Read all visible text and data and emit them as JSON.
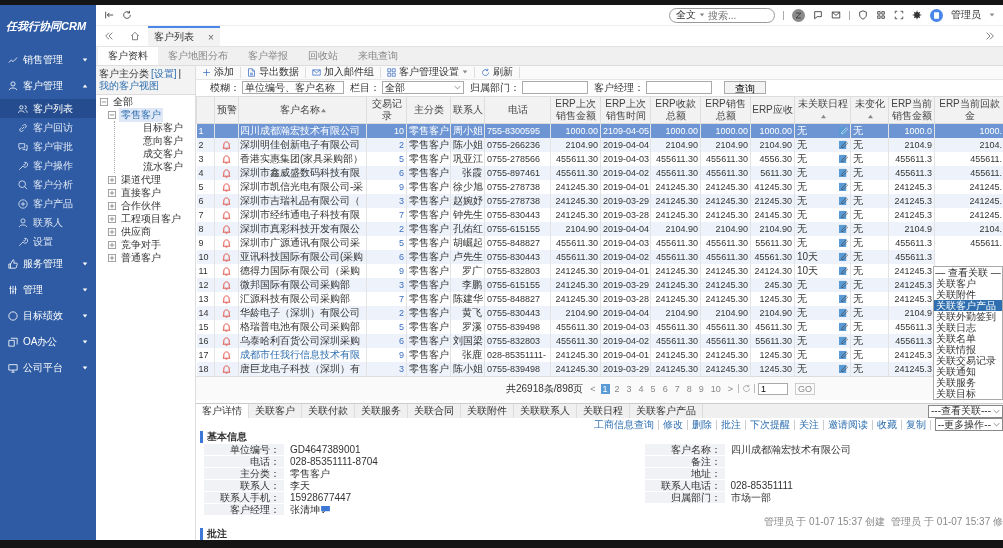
{
  "sidebar": {
    "logo": "任我行协同CRM",
    "menu": [
      {
        "label": "销售管理",
        "expanded": false
      },
      {
        "label": "客户管理",
        "expanded": true,
        "children": [
          {
            "label": "客户列表",
            "selected": true
          },
          {
            "label": "客户回访",
            "selected": false
          },
          {
            "label": "客户审批",
            "selected": false
          },
          {
            "label": "客户操作",
            "selected": false
          },
          {
            "label": "客户分析",
            "selected": false
          },
          {
            "label": "客户产品",
            "selected": false
          },
          {
            "label": "联系人",
            "selected": false
          },
          {
            "label": "设置",
            "selected": false
          }
        ]
      },
      {
        "label": "服务管理",
        "expanded": false
      },
      {
        "label": "管理",
        "expanded": false
      },
      {
        "label": "目标绩效",
        "expanded": false
      },
      {
        "label": "OA办公",
        "expanded": false
      },
      {
        "label": "公司平台",
        "expanded": false
      }
    ]
  },
  "topbar": {
    "search_scope": "全文",
    "search_placeholder": "搜索...",
    "user": "管理员"
  },
  "page_tabs": [
    {
      "label": "客户列表",
      "selected": true,
      "close": "×"
    }
  ],
  "sub_tabs": [
    {
      "label": "客户资料",
      "selected": true
    },
    {
      "label": "客户地图分布",
      "selected": false
    },
    {
      "label": "客户举报",
      "selected": false
    },
    {
      "label": "回收站",
      "selected": false
    },
    {
      "label": "来电查询",
      "selected": false
    }
  ],
  "tree": {
    "title": "客户主分类",
    "settings_link": "[设置]",
    "separator": "|",
    "view_link": "我的客户视图",
    "nodes": [
      {
        "label": "全部",
        "expanded": true,
        "selected": false,
        "children": [
          {
            "label": "零售客户",
            "expanded": true,
            "selected": true,
            "children": [
              {
                "label": "目标客户",
                "selected": false
              },
              {
                "label": "意向客户",
                "selected": false
              },
              {
                "label": "成交客户",
                "selected": false
              },
              {
                "label": "流水客户",
                "selected": false
              }
            ]
          },
          {
            "label": "渠道代理",
            "expanded": false,
            "selected": false
          },
          {
            "label": "直接客户",
            "expanded": false,
            "selected": false
          },
          {
            "label": "合作伙伴",
            "expanded": false,
            "selected": false
          },
          {
            "label": "工程项目客户",
            "expanded": false,
            "selected": false
          },
          {
            "label": "供应商",
            "expanded": false,
            "selected": false
          },
          {
            "label": "竞争对手",
            "expanded": false,
            "selected": false
          },
          {
            "label": "普通客户",
            "expanded": false,
            "selected": false
          }
        ]
      }
    ]
  },
  "toolbar": [
    {
      "label": "添加",
      "dropdown": false
    },
    {
      "label": "导出数据",
      "dropdown": false
    },
    {
      "label": "加入邮件组",
      "dropdown": false
    },
    {
      "label": "客户管理设置",
      "dropdown": true
    },
    {
      "label": "刷新",
      "dropdown": false
    }
  ],
  "filter": {
    "fuzzy_label": "模糊：",
    "fuzzy_placeholder": "单位编号、客户名称",
    "column_label": "栏目：",
    "column_value": "全部",
    "dept_label": "归属部门：",
    "manager_label": "客户经理：",
    "query": "查询"
  },
  "table": {
    "columns": [
      {},
      {
        "label": "预警",
        "sorted": false
      },
      {
        "label": "客户名称",
        "sorted": true
      },
      {
        "label": "交易记录",
        "sorted": false
      },
      {
        "label": "主分类",
        "sorted": false
      },
      {
        "label": "联系人",
        "sorted": false
      },
      {
        "label": "电话",
        "sorted": false
      },
      {
        "label": "ERP上次销售金额",
        "sorted": false
      },
      {
        "label": "ERP上次销售时间",
        "sorted": false
      },
      {
        "label": "ERP收款总额",
        "sorted": false
      },
      {
        "label": "ERP销售总额",
        "sorted": false
      },
      {
        "label": "ERP应收",
        "sorted": false
      },
      {
        "label": "未关联日程",
        "sorted": true
      },
      {
        "label": "未变化",
        "sorted": true
      },
      {
        "label": "ERP当前销售金额",
        "sorted": false
      },
      {
        "label": "ERP当前回款金",
        "sorted": false
      }
    ],
    "rows": [
      {
        "selected": true,
        "alert": false,
        "link": false,
        "cells": [
          "1",
          "",
          "四川成都瀚宏技术有限公司",
          "10",
          "零售客户",
          "周小姐",
          "755-8300595",
          "1000.00",
          "2109-04-05",
          "1000.00",
          "1000.00",
          "1000.00",
          "无",
          "无",
          "1000.0",
          "1000."
        ]
      },
      {
        "selected": false,
        "alert": true,
        "link": false,
        "cells": [
          "2",
          "",
          "深圳明佳创新电子有限公司",
          "2",
          "零售客户",
          "陈小姐",
          "0755-266236",
          "2104.90",
          "2019-04-04",
          "2104.90",
          "2104.90",
          "2104.90",
          "无",
          "无",
          "2104.9",
          "2104."
        ]
      },
      {
        "selected": false,
        "alert": true,
        "link": false,
        "cells": [
          "3",
          "",
          "香港实惠集团(家具采购部）",
          "5",
          "零售客户",
          "巩亚江",
          "0755-278566",
          "455611.30",
          "2019-04-03",
          "455611.30",
          "455611.30",
          "4556.30",
          "无",
          "无",
          "455611.3",
          "455611."
        ]
      },
      {
        "selected": false,
        "alert": true,
        "link": false,
        "cells": [
          "4",
          "",
          "深圳市鑫威盛数码科技有限",
          "6",
          "零售客户",
          "张霞",
          "0755-897461",
          "455611.30",
          "2019-04-02",
          "455611.30",
          "455611.30",
          "5611.30",
          "无",
          "无",
          "455611.3",
          "455611."
        ]
      },
      {
        "selected": false,
        "alert": true,
        "link": false,
        "cells": [
          "5",
          "",
          "深圳市凯信光电有限公司-采",
          "9",
          "零售客户",
          "徐少旭",
          "0755-278738",
          "241245.30",
          "2019-04-01",
          "241245.30",
          "241245.30",
          "41245.30",
          "无",
          "无",
          "241245.3",
          "241245."
        ]
      },
      {
        "selected": false,
        "alert": true,
        "link": false,
        "cells": [
          "6",
          "",
          "深圳市吉瑞礼品有限公司（",
          "3",
          "零售客户",
          "赵婉妤",
          "0755-278738",
          "241245.30",
          "2019-03-29",
          "241245.30",
          "241245.30",
          "21245.30",
          "无",
          "无",
          "241245.3",
          "241245."
        ]
      },
      {
        "selected": false,
        "alert": true,
        "link": false,
        "cells": [
          "7",
          "",
          "深圳市经纬通电子科技有限",
          "7",
          "零售客户",
          "钟先生",
          "0755-830443",
          "241245.30",
          "2019-03-28",
          "241245.30",
          "241245.30",
          "24145.30",
          "无",
          "无",
          "241245.3",
          "241245."
        ]
      },
      {
        "selected": false,
        "alert": true,
        "link": false,
        "cells": [
          "8",
          "",
          "深圳市真彩科技开发有限公",
          "2",
          "零售客户",
          "孔佑红",
          "0755-615155",
          "2104.90",
          "2019-04-04",
          "2104.90",
          "2104.90",
          "2104.90",
          "无",
          "无",
          "2104.9",
          "2104."
        ]
      },
      {
        "selected": false,
        "alert": true,
        "link": false,
        "cells": [
          "9",
          "",
          "深圳市广源通讯有限公司采",
          "5",
          "零售客户",
          "胡崛起",
          "0755-848827",
          "455611.30",
          "2019-04-03",
          "455611.30",
          "455611.30",
          "55611.30",
          "无",
          "无",
          "455611.3",
          "455611."
        ]
      },
      {
        "selected": false,
        "alert": true,
        "link": false,
        "cells": [
          "10",
          "",
          "亚讯科技国际有限公司(采购",
          "6",
          "零售客户",
          "卢先生",
          "0755-830443",
          "455611.30",
          "2019-04-02",
          "455611.30",
          "455611.30",
          "45561.30",
          "10天",
          "无",
          "455611.3"
        ]
      },
      {
        "selected": false,
        "alert": true,
        "link": false,
        "cells": [
          "11",
          "",
          "德得力国际有限公司（采购",
          "9",
          "零售客户",
          "罗广",
          "0755-832803",
          "241245.30",
          "2019-04-01",
          "241245.30",
          "241245.30",
          "24124.30",
          "10天",
          "无",
          "241245.3"
        ]
      },
      {
        "selected": false,
        "alert": true,
        "link": false,
        "cells": [
          "12",
          "",
          "微邦国际有限公司采购部",
          "3",
          "零售客户",
          "李鹏",
          "0755-615155",
          "241245.30",
          "2019-03-29",
          "241245.30",
          "241245.30",
          "245.30",
          "无",
          "无",
          "241245.3"
        ]
      },
      {
        "selected": false,
        "alert": true,
        "link": false,
        "cells": [
          "13",
          "",
          "汇源科技有限公司采购部",
          "7",
          "零售客户",
          "陈建华",
          "0755-848827",
          "241245.30",
          "2019-03-28",
          "241245.30",
          "241245.30",
          "1245.30",
          "无",
          "无",
          "241245.3"
        ]
      },
      {
        "selected": false,
        "alert": true,
        "link": false,
        "cells": [
          "14",
          "",
          "华龄电子（深圳）有限公司",
          "2",
          "零售客户",
          "黄飞",
          "0755-830443",
          "2104.90",
          "2019-04-04",
          "2104.90",
          "2104.90",
          "2104.90",
          "无",
          "无",
          "2104.9"
        ]
      },
      {
        "selected": false,
        "alert": true,
        "link": false,
        "cells": [
          "15",
          "",
          "格瑞普电池有限公司采购部",
          "5",
          "零售客户",
          "罗溪",
          "0755-839498",
          "455611.30",
          "2019-04-03",
          "455611.30",
          "455611.30",
          "45611.30",
          "无",
          "无",
          "455611.3"
        ]
      },
      {
        "selected": false,
        "alert": true,
        "link": false,
        "cells": [
          "16",
          "",
          "乌泰哈利百货公司深圳采购",
          "6",
          "零售客户",
          "刘国梁",
          "0755-832803",
          "455611.30",
          "2019-04-02",
          "455611.30",
          "455611.30",
          "55611.30",
          "无",
          "无",
          "455611.3"
        ]
      },
      {
        "selected": false,
        "alert": true,
        "link": true,
        "cells": [
          "17",
          "",
          "成都市任我行信息技术有限",
          "9",
          "零售客户",
          "张鹿",
          "028-85351111-",
          "241245.30",
          "2019-04-01",
          "241245.30",
          "241245.30",
          "1245.30",
          "无",
          "无",
          "241245.3"
        ]
      },
      {
        "selected": false,
        "alert": true,
        "link": false,
        "cells": [
          "18",
          "",
          "唐巨龙电子科技（深圳）有",
          "3",
          "零售客户",
          "陈小姐",
          "0755-839498",
          "241245.30",
          "2019-03-29",
          "241245.30",
          "241245.30",
          "1245.30",
          "无",
          "无",
          "241245.3"
        ]
      }
    ]
  },
  "pager": {
    "summary": "共26918条/898页",
    "prev": "<",
    "next": ">",
    "pages": [
      {
        "label": "1",
        "selected": true
      },
      {
        "label": "2",
        "selected": false
      },
      {
        "label": "3",
        "selected": false
      },
      {
        "label": "4",
        "selected": false
      },
      {
        "label": "5",
        "selected": false
      },
      {
        "label": "6",
        "selected": false
      },
      {
        "label": "7",
        "selected": false
      },
      {
        "label": "8",
        "selected": false
      },
      {
        "label": "9",
        "selected": false
      },
      {
        "label": "10",
        "selected": false
      }
    ],
    "page_input": "1",
    "go": "GO"
  },
  "related_menu": {
    "header": "— 查看关联 —",
    "items": [
      {
        "label": "关联客户",
        "selected": false
      },
      {
        "label": "关联附件",
        "selected": false
      },
      {
        "label": "关联客户产品",
        "selected": true
      },
      {
        "label": "关联外勤签到",
        "selected": false
      },
      {
        "label": "关联日志",
        "selected": false
      },
      {
        "label": "关联名单",
        "selected": false
      },
      {
        "label": "关联情报",
        "selected": false
      },
      {
        "label": "关联交易记录",
        "selected": false
      },
      {
        "label": "关联通知",
        "selected": false
      },
      {
        "label": "关联服务",
        "selected": false
      },
      {
        "label": "关联目标",
        "selected": false
      }
    ]
  },
  "detail_tabs": [
    {
      "label": "客户详情",
      "selected": true
    },
    {
      "label": "关联客户",
      "selected": false
    },
    {
      "label": "关联付款",
      "selected": false
    },
    {
      "label": "关联服务",
      "selected": false
    },
    {
      "label": "关联合同",
      "selected": false
    },
    {
      "label": "关联附件",
      "selected": false
    },
    {
      "label": "关联联系人",
      "selected": false
    },
    {
      "label": "关联日程",
      "selected": false
    },
    {
      "label": "关联客户产品",
      "selected": false
    }
  ],
  "related_select": "---查看关联---",
  "actions": [
    "工商信息查询",
    "修改",
    "删除",
    "批注",
    "下次提醒",
    "关注",
    "邀请阅读",
    "收藏",
    "复制"
  ],
  "more_select": "--更多操作--",
  "detail": {
    "section": "基本信息",
    "left_fields": [
      {
        "label": "单位编号：",
        "value": "GD4647389001"
      },
      {
        "label": "电话：",
        "value": "028-85351111-8704"
      },
      {
        "label": "主分类：",
        "value": "零售客户"
      },
      {
        "label": "联系人：",
        "value": "李天"
      },
      {
        "label": "联系人手机：",
        "value": "15928677447"
      },
      {
        "label": "客户经理：",
        "value": "张清坤",
        "chat": true
      }
    ],
    "right_fields": [
      {
        "label": "客户名称：",
        "value": "四川成都瀚宏技术有限公司"
      },
      {
        "label": "备注："
      },
      {
        "label": "地址："
      },
      {
        "label": "联系人电话：",
        "value": "028-85351111"
      },
      {
        "label": "归属部门：",
        "value": "市场一部"
      }
    ],
    "meta": [
      "管理员 于 01-07 15:37 创建",
      "管理员 于 01-07 15:37 修"
    ],
    "notes_section": "批注"
  }
}
